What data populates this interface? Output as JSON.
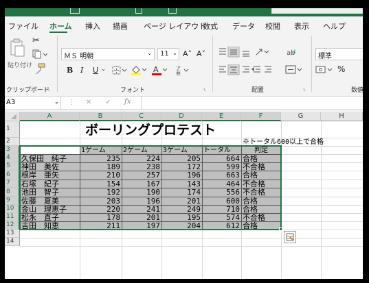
{
  "ribbon_tabs": [
    "ファイル",
    "ホーム",
    "挿入",
    "描画",
    "ページ レイアウト",
    "数式",
    "データ",
    "校閲",
    "表示",
    "ヘルプ"
  ],
  "ribbon": {
    "paste_label": "貼り付け",
    "clipboard_label": "クリップボード",
    "font_name": "ＭＳ 明朝",
    "font_size": "11",
    "font_label": "フォント",
    "align_label": "配置",
    "number_format": "標準",
    "number_label": "数値",
    "bold": "B",
    "italic": "I",
    "underline": "U",
    "grow_font": "A˄",
    "shrink_font": "A˅",
    "percent": "%"
  },
  "formula_bar": {
    "name_box": "A3",
    "fx": "fx",
    "cancel": "✕",
    "confirm": "✓",
    "value": ""
  },
  "columns": [
    "A",
    "B",
    "C",
    "D",
    "E",
    "F",
    "G",
    "H"
  ],
  "rows": [
    "1",
    "2",
    "3",
    "4",
    "5",
    "6",
    "7",
    "8",
    "9",
    "10",
    "11",
    "12",
    "13",
    "14"
  ],
  "sheet": {
    "title": "ボーリングプロテスト",
    "note": "※トータル600以上で合格",
    "headers": [
      "",
      "1ゲーム",
      "2ゲーム",
      "3ゲーム",
      "トータル",
      "判定"
    ],
    "records": [
      [
        "久保田　純子",
        "235",
        "224",
        "205",
        "664",
        "合格"
      ],
      [
        "神田　美佐",
        "189",
        "238",
        "172",
        "599",
        "不合格"
      ],
      [
        "根岸　亜矢",
        "210",
        "257",
        "196",
        "663",
        "合格"
      ],
      [
        "石塚　紀子",
        "154",
        "167",
        "143",
        "464",
        "不合格"
      ],
      [
        "池田　智子",
        "192",
        "190",
        "174",
        "556",
        "不合格"
      ],
      [
        "佐藤　夏美",
        "203",
        "196",
        "201",
        "600",
        "合格"
      ],
      [
        "金山　理恵子",
        "220",
        "241",
        "249",
        "710",
        "合格"
      ],
      [
        "松永　直子",
        "178",
        "201",
        "195",
        "574",
        "不合格"
      ],
      [
        "吉田　知恵",
        "211",
        "197",
        "204",
        "612",
        "合格"
      ]
    ]
  },
  "colors": {
    "accent": "#217346",
    "selection_fill": "#bfbfbf"
  }
}
